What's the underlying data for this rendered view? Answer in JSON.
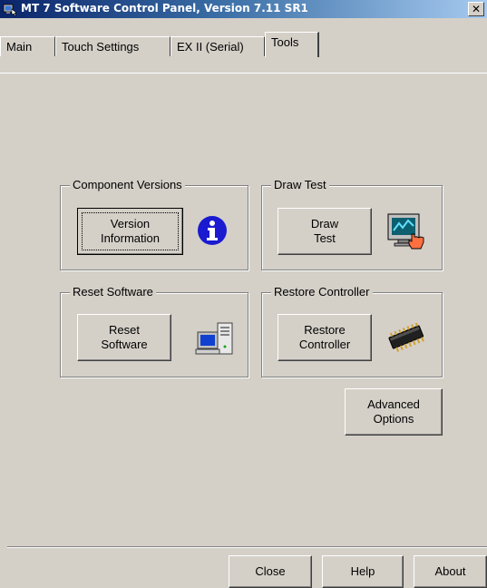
{
  "window": {
    "title": "MT 7 Software Control Panel, Version 7.11 SR1",
    "close_glyph": "✕"
  },
  "tabs": [
    {
      "label": "Main",
      "active": false
    },
    {
      "label": "Touch Settings",
      "active": false
    },
    {
      "label": "EX II (Serial)",
      "active": false
    },
    {
      "label": "Tools",
      "active": true
    }
  ],
  "groups": {
    "component_versions": {
      "label": "Component Versions",
      "button": "Version\nInformation",
      "icon": "info-icon"
    },
    "draw_test": {
      "label": "Draw Test",
      "button": "Draw\nTest",
      "icon": "monitor-touch-icon"
    },
    "reset_software": {
      "label": "Reset Software",
      "button": "Reset\nSoftware",
      "icon": "computer-icon"
    },
    "restore_controller": {
      "label": "Restore Controller",
      "button": "Restore\nController",
      "icon": "chip-icon"
    }
  },
  "advanced_button": "Advanced\nOptions",
  "footer": {
    "close": "Close",
    "help": "Help",
    "about": "About"
  },
  "colors": {
    "face": "#d4d0c8",
    "title_start": "#0a246a",
    "title_end": "#a6caf0",
    "info_blue": "#1a1ad0"
  }
}
